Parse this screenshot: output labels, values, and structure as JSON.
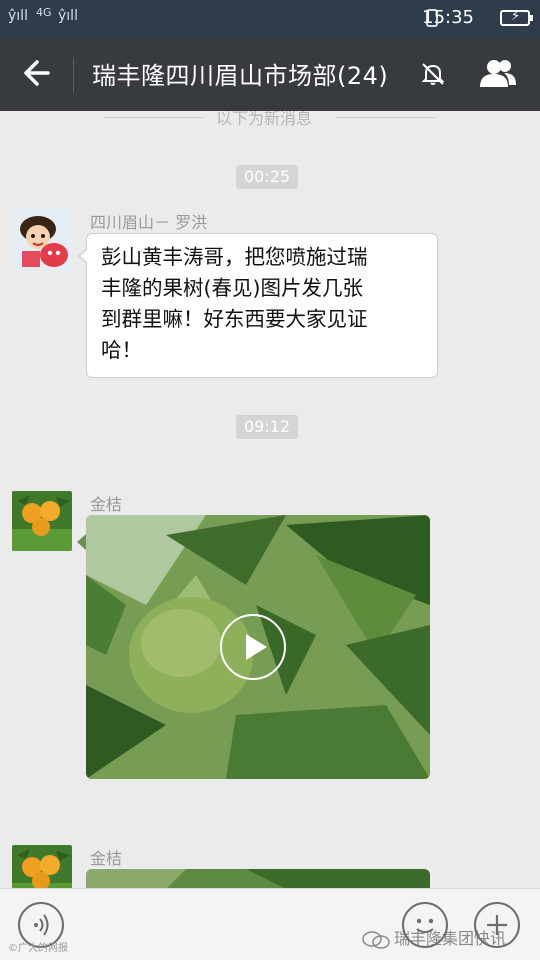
{
  "status_bar": {
    "signal_left": "ŷıll",
    "network": "4G",
    "signal_right": "ŷıll",
    "time": "15:35"
  },
  "header": {
    "title": "瑞丰隆四川眉山市场部(24)",
    "back_icon": "back-arrow-icon",
    "mute_icon": "mute-bell-icon",
    "members_icon": "group-members-icon"
  },
  "chat": {
    "new_messages_divider": "以下为新消息",
    "timestamps": [
      "00:25",
      "09:12"
    ],
    "messages": [
      {
        "sender": "四川眉山－ 罗洪",
        "type": "text",
        "text_lines": [
          "彭山黄丰涛哥，把您喷施过瑞",
          "丰隆的果树(春见)图片发几张",
          "到群里嘛！好东西要大家见证",
          "哈！"
        ]
      },
      {
        "sender": "金桔",
        "type": "video",
        "content": "green citrus fruit on tree"
      },
      {
        "sender": "金桔",
        "type": "video",
        "content": "green citrus fruit on tree"
      }
    ]
  },
  "input_bar": {
    "voice_icon": "voice-input-icon",
    "emoji_icon": "emoji-icon",
    "plus_icon": "plus-icon",
    "watermark_text": "瑞丰隆集团快讯",
    "watermark_left": "©广大的网报"
  },
  "colors": {
    "status_bar": "#2f3c4c",
    "header": "#373a3f",
    "chat_background": "#ebebeb",
    "bubble": "#ffffff"
  }
}
